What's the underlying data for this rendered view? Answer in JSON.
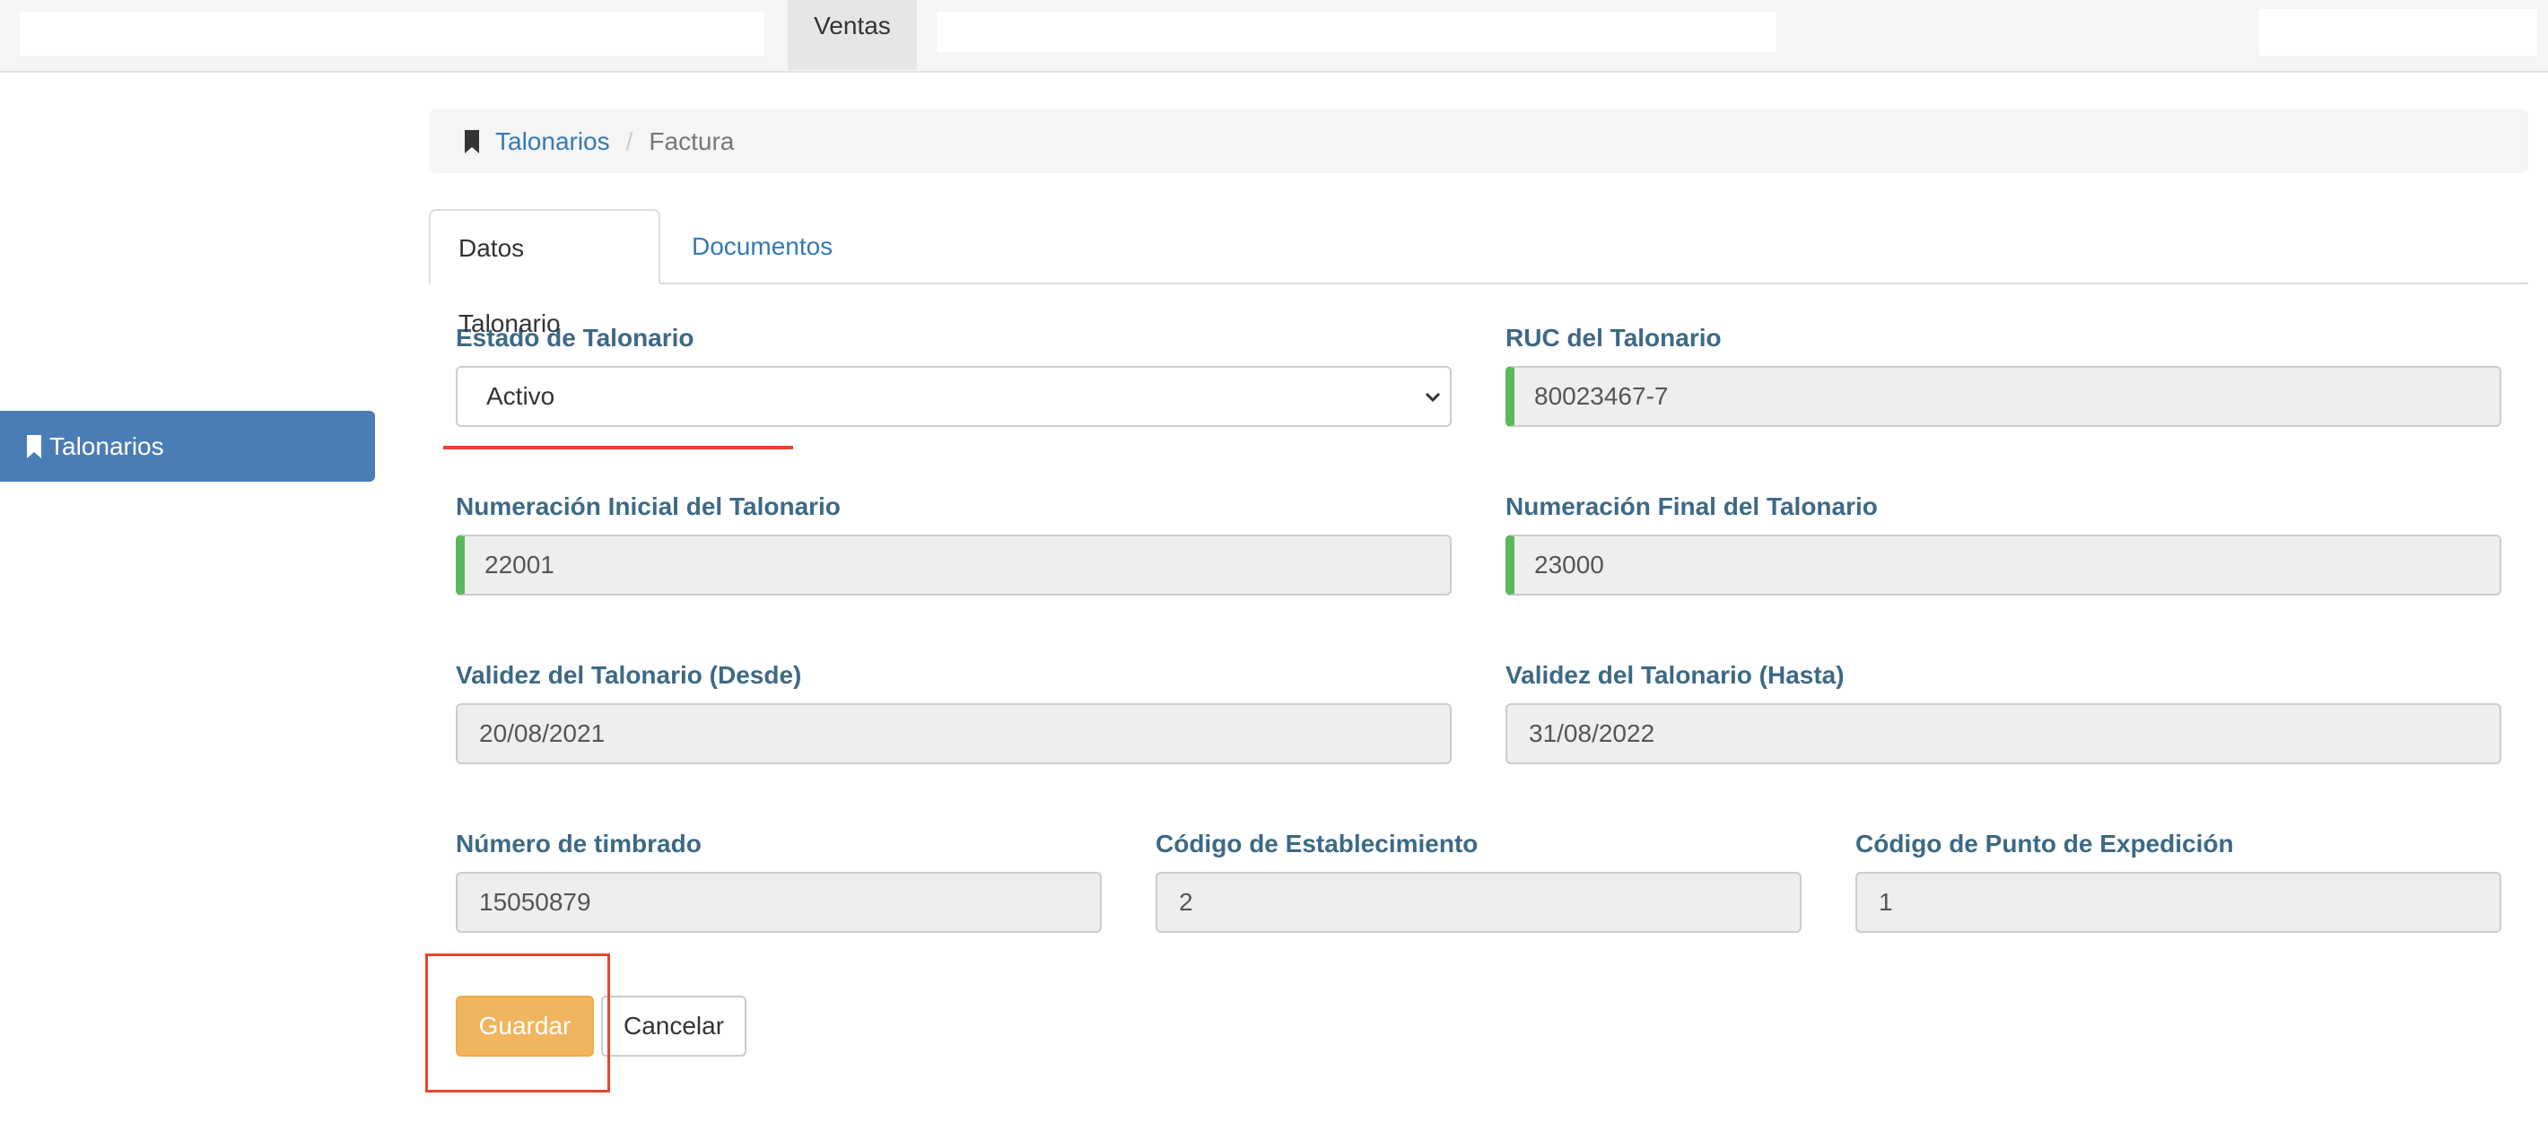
{
  "topbar": {
    "active_tab": "Ventas"
  },
  "sidebar": {
    "items": [
      {
        "label": "Talonarios",
        "icon": "bookmark-icon"
      }
    ]
  },
  "breadcrumb": {
    "items": [
      "Talonarios",
      "Factura"
    ],
    "separator": "/"
  },
  "tabs": [
    {
      "label": "Datos Talonario",
      "active": true
    },
    {
      "label": "Documentos",
      "active": false
    }
  ],
  "form": {
    "estado": {
      "label": "Estado de Talonario",
      "value": "Activo"
    },
    "ruc": {
      "label": "RUC del Talonario",
      "value": "80023467-7"
    },
    "num_inicial": {
      "label": "Numeración Inicial del Talonario",
      "value": "22001"
    },
    "num_final": {
      "label": "Numeración Final del Talonario",
      "value": "23000"
    },
    "validez_desde": {
      "label": "Validez del Talonario (Desde)",
      "value": "20/08/2021"
    },
    "validez_hasta": {
      "label": "Validez del Talonario (Hasta)",
      "value": "31/08/2022"
    },
    "timbrado": {
      "label": "Número de timbrado",
      "value": "15050879"
    },
    "establecimiento": {
      "label": "Código de Establecimiento",
      "value": "2"
    },
    "punto_expedicion": {
      "label": "Código de Punto de Expedición",
      "value": "1"
    }
  },
  "actions": {
    "save_label": "Guardar",
    "cancel_label": "Cancelar"
  },
  "colors": {
    "primary": "#337ab7",
    "sidebar_active": "#4a7db5",
    "warning": "#f0ad4e",
    "success": "#5cb85c",
    "label": "#3d6985",
    "annotation": "#e8452c"
  }
}
